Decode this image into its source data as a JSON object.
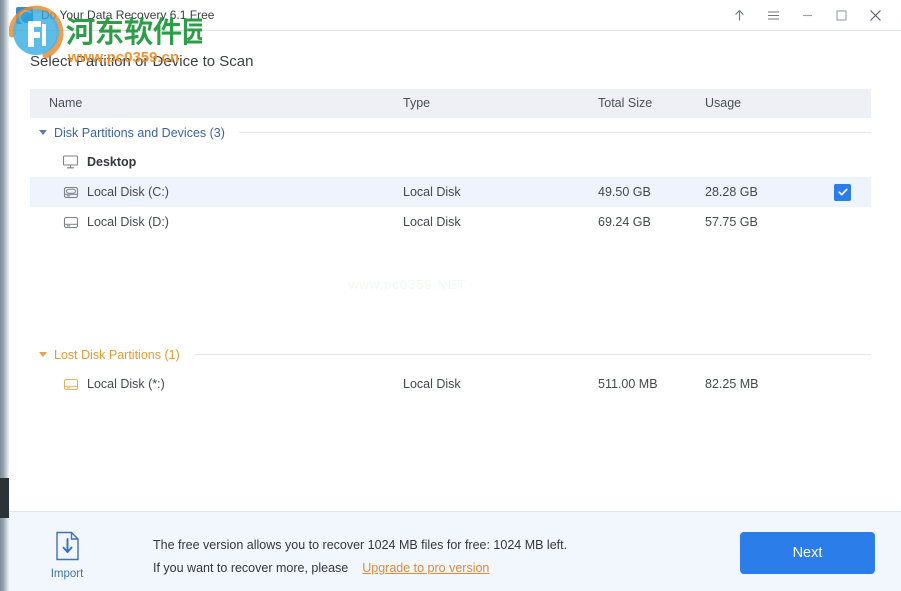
{
  "window": {
    "app_title": "Do Your Data Recovery 6.1 Free",
    "app_icon": "recovery-circle-icon",
    "controls": {
      "upload": "up-arrow-icon",
      "menu": "hamburger-menu-icon",
      "minimize": "minimize-icon",
      "maximize": "maximize-icon",
      "close": "close-icon"
    }
  },
  "page": {
    "heading": "Select Partition or Device to Scan"
  },
  "table": {
    "columns": [
      "Name",
      "Type",
      "Total Size",
      "Usage"
    ],
    "groups": [
      {
        "label": "Disk Partitions and Devices (3)",
        "color": "#3a63a8",
        "rows": [
          {
            "name": "Desktop",
            "type": "",
            "total_size": "",
            "usage": "",
            "icon": "monitor-icon",
            "is_device": true,
            "selected": false,
            "checked": false
          },
          {
            "name": "Local Disk (C:)",
            "type": "Local Disk",
            "total_size": "49.50 GB",
            "usage": "28.28 GB",
            "icon": "os-drive-icon",
            "is_device": false,
            "selected": true,
            "checked": true
          },
          {
            "name": "Local Disk (D:)",
            "type": "Local Disk",
            "total_size": "69.24 GB",
            "usage": "57.75 GB",
            "icon": "drive-icon",
            "is_device": false,
            "selected": false,
            "checked": false
          }
        ]
      },
      {
        "label": "Lost Disk Partitions (1)",
        "color": "#e8992f",
        "rows": [
          {
            "name": "Local Disk (*:)",
            "type": "Local Disk",
            "total_size": "511.00 MB",
            "usage": "82.25 MB",
            "icon": "lost-drive-icon",
            "is_device": false,
            "selected": false,
            "checked": false
          }
        ]
      }
    ]
  },
  "watermark": {
    "site_cn": "河东软件园",
    "site_url": "www.pc0359.cn",
    "center_text": "www.pc0359.NET"
  },
  "footer": {
    "import_label": "Import",
    "import_icon": "import-document-icon",
    "message_line1": "The free version allows you to recover 1024 MB files for free: 1024 MB left.",
    "message_line2": "If you want to recover more, please",
    "upgrade_link": "Upgrade to pro version",
    "next_label": "Next"
  },
  "colors": {
    "accent_blue": "#2b7de9",
    "group_blue": "#3a63a8",
    "lost_orange": "#e8992f",
    "link_orange": "#e08b3a",
    "header_bg": "#eef0f5",
    "footer_bg": "#f2f7fd",
    "row_selected": "#eef4fd"
  }
}
